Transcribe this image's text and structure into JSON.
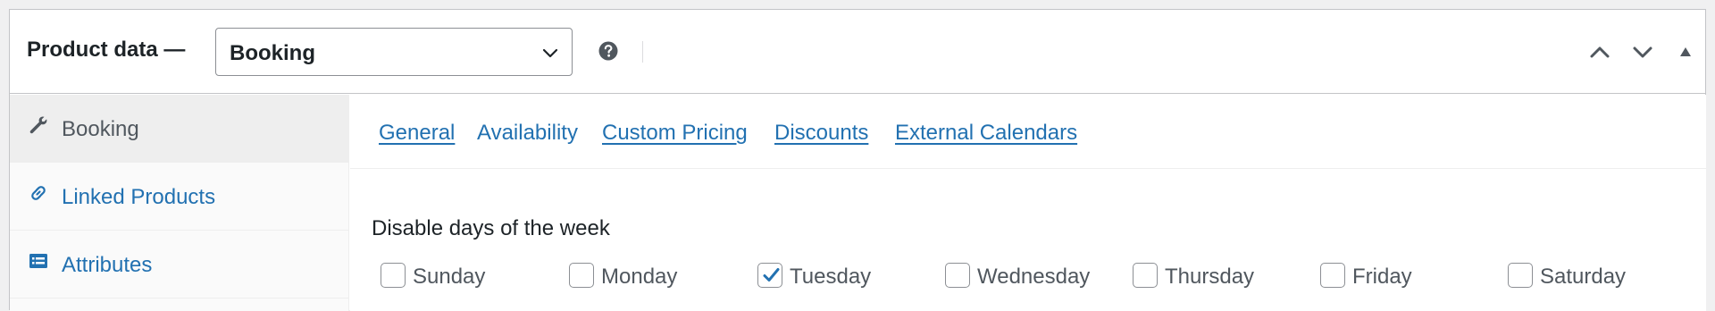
{
  "header": {
    "title": "Product data —",
    "product_type": {
      "value": "Booking",
      "options": [
        "Booking"
      ]
    },
    "help_icon": "question-circle-icon",
    "controls": [
      "chevron-up-icon",
      "chevron-down-icon",
      "triangle-up-icon"
    ]
  },
  "sidebar": {
    "tabs": [
      {
        "label": "Booking",
        "icon": "wrench-icon",
        "active": true
      },
      {
        "label": "Linked Products",
        "icon": "link-icon",
        "active": false
      },
      {
        "label": "Attributes",
        "icon": "list-view-icon",
        "active": false
      }
    ]
  },
  "subnav": {
    "links": [
      {
        "label": "General"
      },
      {
        "label": "Availability",
        "current": true
      },
      {
        "label": "Custom Pricing"
      },
      {
        "label": "Discounts"
      },
      {
        "label": "External Calendars"
      }
    ]
  },
  "disable_days": {
    "label": "Disable days of the week",
    "days": [
      {
        "label": "Sunday",
        "checked": false
      },
      {
        "label": "Monday",
        "checked": false
      },
      {
        "label": "Tuesday",
        "checked": true
      },
      {
        "label": "Wednesday",
        "checked": false
      },
      {
        "label": "Thursday",
        "checked": false
      },
      {
        "label": "Friday",
        "checked": false
      },
      {
        "label": "Saturday",
        "checked": false
      }
    ]
  },
  "colors": {
    "link": "#2271b1",
    "checkmark": "#2271b1",
    "border": "#c3c4c7"
  }
}
